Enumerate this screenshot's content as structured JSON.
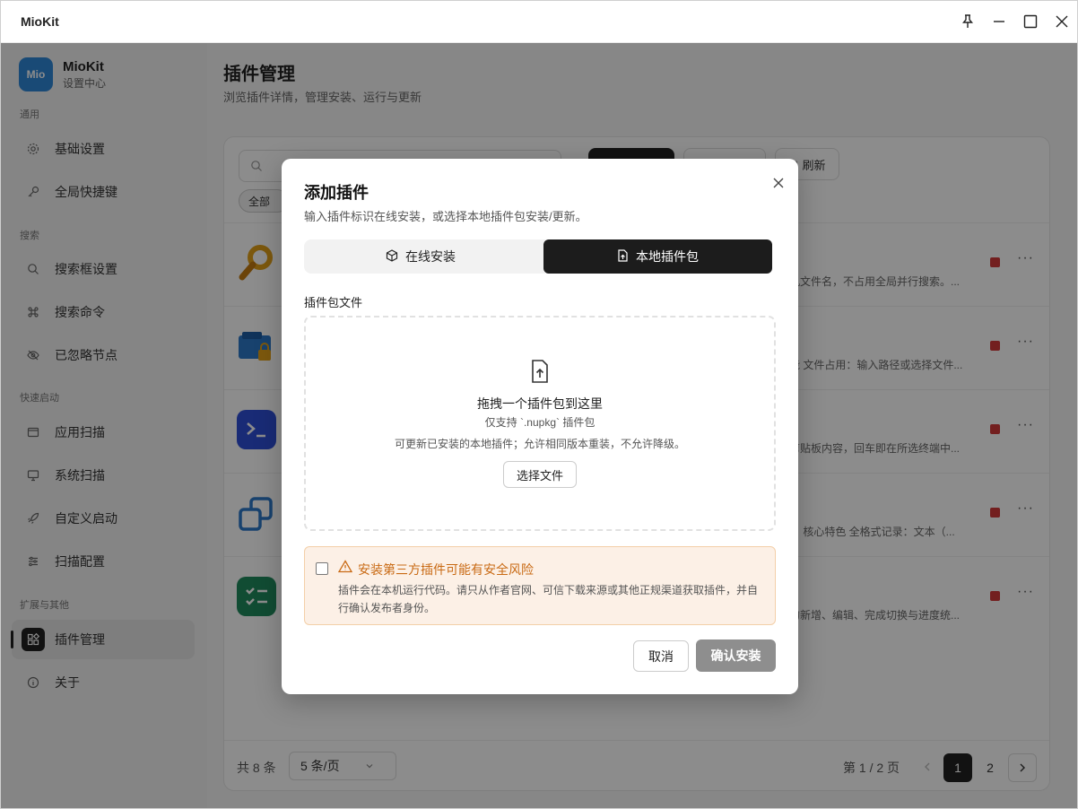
{
  "window": {
    "title": "MioKit"
  },
  "brand": {
    "logo_text": "Mio",
    "name": "MioKit",
    "subtitle": "设置中心"
  },
  "sidebar": {
    "sections": [
      "通用",
      "搜索",
      "快速启动",
      "扩展与其他"
    ],
    "items": [
      {
        "label": "基础设置",
        "icon": "gear-icon"
      },
      {
        "label": "全局快捷键",
        "icon": "key-icon"
      },
      {
        "label": "搜索框设置",
        "icon": "search-icon"
      },
      {
        "label": "搜索命令",
        "icon": "command-icon"
      },
      {
        "label": "已忽略节点",
        "icon": "eye-off-icon"
      },
      {
        "label": "应用扫描",
        "icon": "window-icon"
      },
      {
        "label": "系统扫描",
        "icon": "monitor-icon"
      },
      {
        "label": "自定义启动",
        "icon": "rocket-icon"
      },
      {
        "label": "扫描配置",
        "icon": "sliders-icon"
      },
      {
        "label": "插件管理",
        "icon": "puzzle-icon"
      },
      {
        "label": "关于",
        "icon": "info-icon"
      }
    ]
  },
  "main": {
    "title": "插件管理",
    "subtitle": "浏览插件详情，管理安装、运行与更新",
    "refresh_label": "刷新",
    "filter_all": "全部",
    "rows": [
      {
        "desc": "机文件名，不占用全局并行搜索。..."
      },
      {
        "desc": "能 文件占用：输入路径或选择文件..."
      },
      {
        "desc": "剪贴板内容，回车即在所选终端中..."
      },
      {
        "desc": "。 核心特色 全格式记录：文本（..."
      },
      {
        "desc": "的新增、编辑、完成切换与进度统..."
      }
    ],
    "pager": {
      "total": "共 8 条",
      "page_size": "5 条/页",
      "page_info": "第 1 / 2 页",
      "pages": [
        "1",
        "2"
      ]
    }
  },
  "dialog": {
    "title": "添加插件",
    "subtitle": "输入插件标识在线安装，或选择本地插件包安装/更新。",
    "tabs": [
      "在线安装",
      "本地插件包"
    ],
    "field_label": "插件包文件",
    "dropzone": {
      "title": "拖拽一个插件包到这里",
      "hint": "仅支持 `.nupkg` 插件包",
      "note": "可更新已安装的本地插件；允许相同版本重装，不允许降级。",
      "button": "选择文件"
    },
    "warning": {
      "title": "安装第三方插件可能有安全风险",
      "body": "插件会在本机运行代码。请只从作者官网、可信下载来源或其他正规渠道获取插件，并自行确认发布者身份。",
      "checked": false
    },
    "cancel": "取消",
    "confirm": "确认安装"
  }
}
